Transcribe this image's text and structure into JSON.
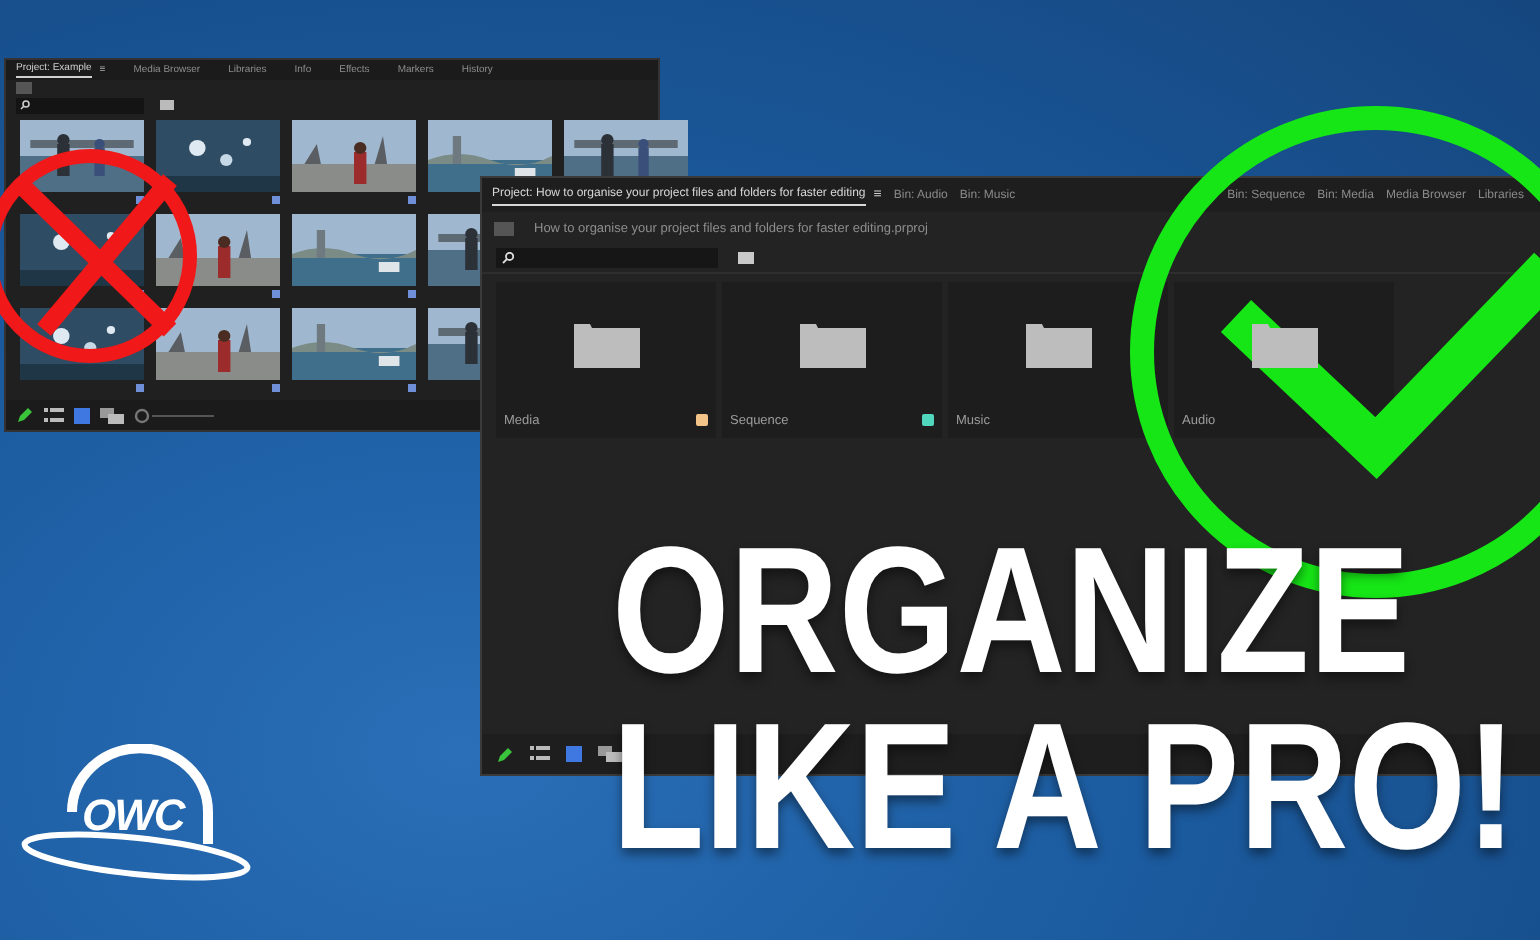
{
  "small_panel": {
    "tabs": [
      {
        "label": "Project: Example",
        "selected": true
      },
      {
        "label": "Media Browser",
        "selected": false
      },
      {
        "label": "Libraries",
        "selected": false
      },
      {
        "label": "Info",
        "selected": false
      },
      {
        "label": "Effects",
        "selected": false
      },
      {
        "label": "Markers",
        "selected": false
      },
      {
        "label": "History",
        "selected": false
      }
    ],
    "menu": "≡"
  },
  "big_panel": {
    "tabs": [
      {
        "label": "Project: How to organise your project files and folders for faster editing",
        "selected": true
      },
      {
        "label": "Bin: Audio",
        "selected": false
      },
      {
        "label": "Bin: Music",
        "selected": false
      },
      {
        "label": "Bin: Sequence",
        "selected": false
      },
      {
        "label": "Bin: Media",
        "selected": false
      },
      {
        "label": "Media Browser",
        "selected": false
      },
      {
        "label": "Libraries",
        "selected": false
      }
    ],
    "menu": "≡",
    "project_path": "How to organise your project files and folders for faster editing.prproj",
    "folders": [
      {
        "kind": "folder",
        "name": "Media",
        "color": "#f2c487"
      },
      {
        "kind": "folder",
        "name": "Sequence",
        "color": "#4fd6bd"
      },
      {
        "kind": "folder",
        "name": "Music"
      },
      {
        "kind": "folder",
        "name": "Audio"
      }
    ]
  },
  "headline": "ORGANIZE LIKE A PRO!",
  "logo": "OWC"
}
